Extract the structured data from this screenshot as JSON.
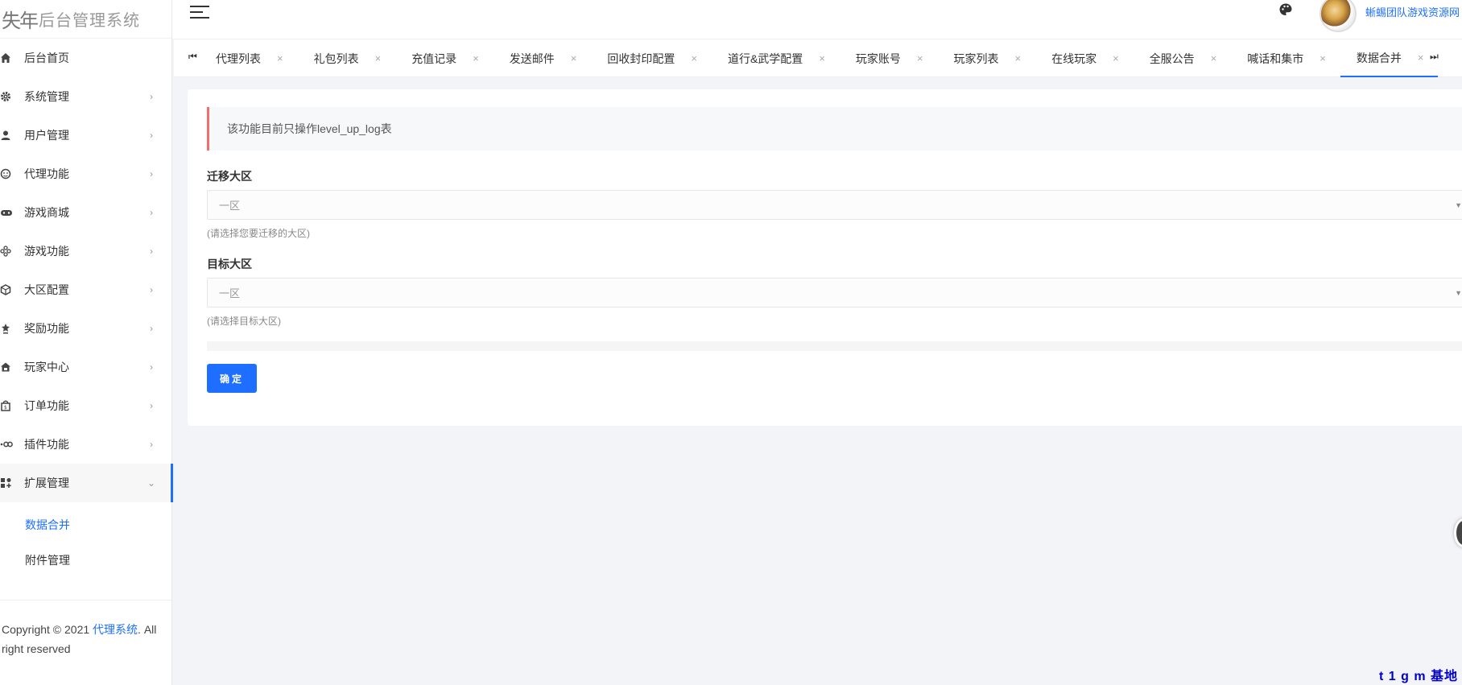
{
  "app": {
    "logo_mark": "失年",
    "logo_text": "后台管理系统",
    "username": "蜥蜴团队游戏资源网"
  },
  "sidebar": {
    "items": [
      {
        "label": "后台首页",
        "icon": "home-icon",
        "arrow": ""
      },
      {
        "label": "系统管理",
        "icon": "gear-icon",
        "arrow": "›"
      },
      {
        "label": "用户管理",
        "icon": "user-icon",
        "arrow": "›"
      },
      {
        "label": "代理功能",
        "icon": "face-icon",
        "arrow": "›"
      },
      {
        "label": "游戏商城",
        "icon": "gamepad-icon",
        "arrow": "›"
      },
      {
        "label": "游戏功能",
        "icon": "joystick-icon",
        "arrow": "›"
      },
      {
        "label": "大区配置",
        "icon": "cube-icon",
        "arrow": "›"
      },
      {
        "label": "奖励功能",
        "icon": "trophy-icon",
        "arrow": "›"
      },
      {
        "label": "玩家中心",
        "icon": "house-icon",
        "arrow": "›"
      },
      {
        "label": "订单功能",
        "icon": "bag-icon",
        "arrow": "›"
      },
      {
        "label": "插件功能",
        "icon": "link-icon",
        "arrow": "›"
      },
      {
        "label": "扩展管理",
        "icon": "apps-icon",
        "arrow": "⌄"
      }
    ],
    "subitems": [
      {
        "label": "数据合并"
      },
      {
        "label": "附件管理"
      }
    ],
    "footer": {
      "prefix": "Copyright © 2021 ",
      "link": "代理系统",
      "suffix": ". All right reserved"
    }
  },
  "tabs": {
    "prev": "⏮",
    "next": "⏭",
    "close": "×",
    "items": [
      {
        "label": "代理列表"
      },
      {
        "label": "礼包列表"
      },
      {
        "label": "充值记录"
      },
      {
        "label": "发送邮件"
      },
      {
        "label": "回收封印配置"
      },
      {
        "label": "道行&武学配置"
      },
      {
        "label": "玩家账号"
      },
      {
        "label": "玩家列表"
      },
      {
        "label": "在线玩家"
      },
      {
        "label": "全服公告"
      },
      {
        "label": "喊话和集市"
      },
      {
        "label": "数据合并"
      }
    ]
  },
  "form": {
    "alert": "该功能目前只操作level_up_log表",
    "source_label": "迁移大区",
    "source_value": "一区",
    "source_hint": "(请选择您要迁移的大区)",
    "target_label": "目标大区",
    "target_value": "一区",
    "target_hint": "(请选择目标大区)",
    "submit": "确定"
  },
  "watermark": "t 1 g m 基地",
  "colors": {
    "accent": "#1e6fff",
    "alert_border": "#f56c6c",
    "background": "#f3f4f8"
  }
}
